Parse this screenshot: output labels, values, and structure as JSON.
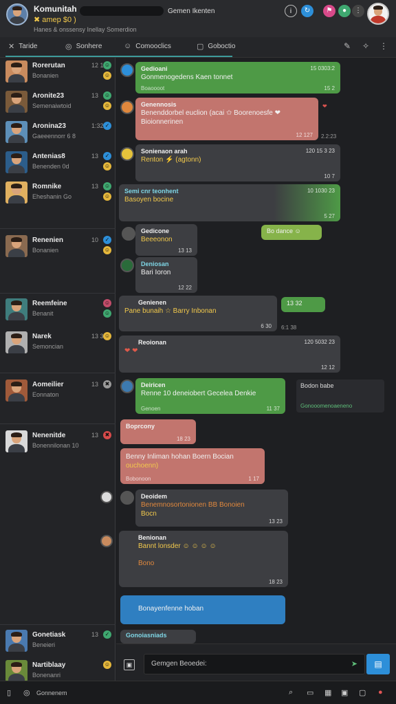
{
  "header": {
    "title": "Komunitah",
    "subtitle": "✖ amep $0 )",
    "description": "Hanes & onssensy Inellay Somerdion",
    "center": "Gemen Ikenten"
  },
  "tabs": {
    "items": [
      {
        "label": "Taride",
        "icon": "cross-icon"
      },
      {
        "label": "Sonhere",
        "icon": "globe-icon"
      },
      {
        "label": "Comooclics",
        "icon": "person-icon"
      },
      {
        "label": "Goboctio",
        "icon": "window-icon"
      }
    ]
  },
  "contacts": [
    {
      "name": "Rorerutan",
      "sub": "Bonanien",
      "time": "12 16",
      "badges": [
        {
          "glyph": "☺",
          "color": "#3fa870"
        },
        {
          "glyph": "☺",
          "color": "#e5b73b"
        }
      ]
    },
    {
      "name": "Aronite23",
      "sub": "Semenaiwtoid",
      "time": "13",
      "badges": [
        {
          "glyph": "☺",
          "color": "#3fa870"
        },
        {
          "glyph": "☺",
          "color": "#e5b73b"
        }
      ]
    },
    {
      "name": "Aronina23",
      "sub": "Gaeeennorr 6 8",
      "time": "1:32",
      "badges": [
        {
          "glyph": "✓",
          "color": "#2d8fd9"
        }
      ]
    },
    {
      "name": "Antenias8",
      "sub": "Benenden 0d",
      "time": "13",
      "badges": [
        {
          "glyph": "✓",
          "color": "#2d8fd9"
        },
        {
          "glyph": "☺",
          "color": "#e5b73b"
        }
      ]
    },
    {
      "name": "Romnike",
      "sub": "Eheshanin Go",
      "time": "13",
      "badges": [
        {
          "glyph": "☺",
          "color": "#3fa870"
        },
        {
          "glyph": "☺",
          "color": "#e5b73b"
        }
      ]
    },
    {
      "name": "Renenien",
      "sub": "Bonanien",
      "time": "10",
      "badges": [
        {
          "glyph": "✓",
          "color": "#2d8fd9"
        },
        {
          "glyph": "☺",
          "color": "#e5b73b"
        }
      ]
    },
    {
      "name": "Reemfeine",
      "sub": "Benanit",
      "time": "",
      "badges": [
        {
          "glyph": "☺",
          "color": "#c24c6a"
        },
        {
          "glyph": "☺",
          "color": "#3fa870"
        }
      ]
    },
    {
      "name": "Narek",
      "sub": "Semoncian",
      "time": "13 30",
      "badges": [
        {
          "glyph": "☺",
          "color": "#e5b73b"
        }
      ]
    },
    {
      "name": "Aomeilier",
      "sub": "Eonnaton",
      "time": "13",
      "badges": [
        {
          "glyph": "✖",
          "color": "#9a9a9a"
        }
      ]
    },
    {
      "name": "Nenenitde",
      "sub": "Bonennilonan 10",
      "time": "13",
      "badges": [
        {
          "glyph": "✖",
          "color": "#d84a4a"
        }
      ]
    },
    {
      "name": "Gonetiask",
      "sub": "Beneieri",
      "time": "13",
      "badges": [
        {
          "glyph": "✓",
          "color": "#3fa870"
        }
      ]
    },
    {
      "name": "Nartiblaay",
      "sub": "Bonenanri",
      "time": "",
      "badges": [
        {
          "glyph": "☺",
          "color": "#e5b73b"
        }
      ]
    }
  ],
  "messages": [
    {
      "name": "Gedioani",
      "text": "Gonmenogedens Kaen tonnet",
      "meta": "Boaoooot",
      "head": "15 0303:2",
      "foot": "15 2"
    },
    {
      "name": "Genennosis",
      "text": "Benenddorbel euclion (acai ✩  Boorenoesfe ❤",
      "text2": "Bioionnerinen",
      "foot": "12 127"
    },
    {
      "name": "Sonienaon arah",
      "text": "Renton ⚡ (agtonn)",
      "head": "120 15 3 23",
      "foot": "10 7"
    },
    {
      "name": "Semi cnr teonhent",
      "text": "Basoyen bocine",
      "head": "10 1030 23",
      "foot": "5 27"
    },
    {
      "name": "Gedicone",
      "text": "Beeeonon",
      "foot": "13 13"
    },
    {
      "name": "Deniosan",
      "text": "Bari Ioron",
      "foot": "12 22"
    },
    {
      "name": "Genienen",
      "text": "Pane bunaih ☆ Barry Inbonan",
      "foot": "6 30"
    },
    {
      "name": "Reoionan",
      "text": "❤ ❤",
      "head": "120 5032 23",
      "foot": "12 12"
    },
    {
      "name": "Deiricen",
      "text": "Renne 10 deneiobert Gecelea Denkie",
      "meta": "Genoen",
      "foot": "11 37"
    },
    {
      "name": "Boprcony",
      "foot": "18 23"
    },
    {
      "name": "",
      "text": "Benny Inliman hohan Boern Bocian",
      "text2": "ouchoenn)",
      "meta": "Bobonoon",
      "foot": "1 17"
    },
    {
      "name": "Deoidem",
      "text": "Benemnosortonionen BB Bonoien",
      "text2": "Bocn",
      "foot": "13 23"
    },
    {
      "name": "Benionan",
      "text": "Bannt lonsder ☺ ☺ ☺ ☺",
      "text2": "Bono",
      "foot": "18 23"
    },
    {
      "name": "",
      "text": "Bonayenfenne hoban"
    },
    {
      "name": "Gonoiasniads"
    }
  ],
  "side_notes": {
    "badge_right": "Bo dance ☺",
    "stamp_1": "2.2:23",
    "badge_2": "13 32",
    "stamp_2": "6:1 38",
    "card_title": "Bodon babe",
    "card_sub": "Gonooomenoaeneno"
  },
  "composer": {
    "placeholder": "Gemgen Beoedei:"
  },
  "status_bar": {
    "label": "Gonnenem"
  }
}
